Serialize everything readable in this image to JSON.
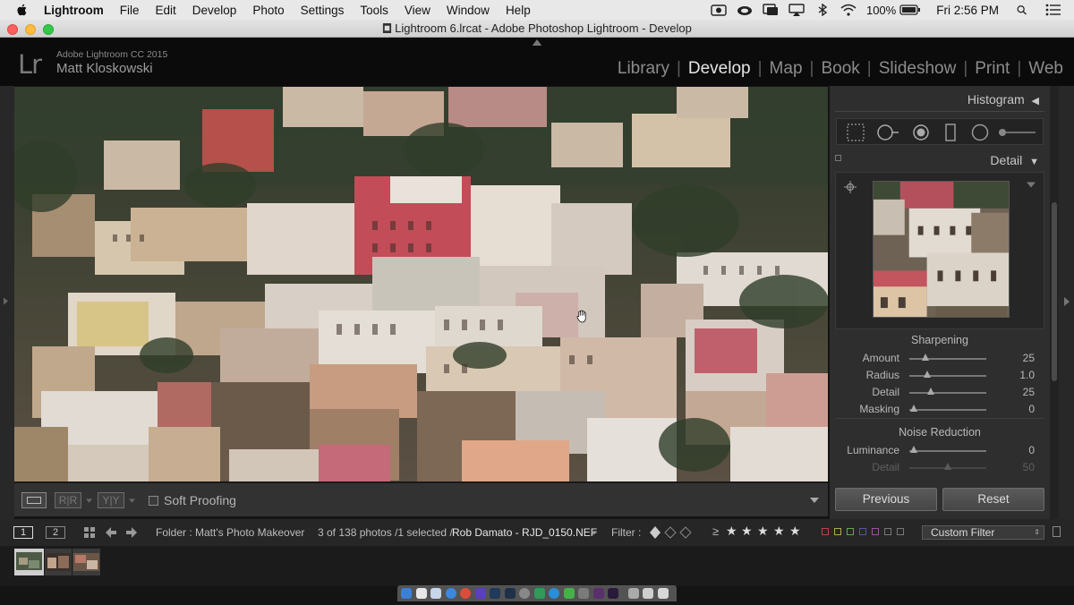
{
  "menubar": {
    "items": [
      "Lightroom",
      "File",
      "Edit",
      "Develop",
      "Photo",
      "Settings",
      "Tools",
      "View",
      "Window",
      "Help"
    ],
    "battery": "100%",
    "clock": "Fri 2:56 PM"
  },
  "window": {
    "title": "Lightroom 6.lrcat - Adobe Photoshop Lightroom - Develop"
  },
  "identity": {
    "logo": "Lr",
    "product": "Adobe Lightroom CC 2015",
    "user": "Matt Kloskowski"
  },
  "modules": [
    "Library",
    "Develop",
    "Map",
    "Book",
    "Slideshow",
    "Print",
    "Web"
  ],
  "active_module": "Develop",
  "right_panel": {
    "histogram_label": "Histogram",
    "detail_label": "Detail",
    "sharpening": {
      "title": "Sharpening",
      "sliders": [
        {
          "label": "Amount",
          "value": "25"
        },
        {
          "label": "Radius",
          "value": "1.0"
        },
        {
          "label": "Detail",
          "value": "25"
        },
        {
          "label": "Masking",
          "value": "0"
        }
      ]
    },
    "noise": {
      "title": "Noise Reduction",
      "sliders": [
        {
          "label": "Luminance",
          "value": "0"
        },
        {
          "label": "Detail",
          "value": "50"
        }
      ]
    },
    "previous_label": "Previous",
    "reset_label": "Reset"
  },
  "toolbar": {
    "soft_proofing_label": "Soft Proofing",
    "compare_ab": "R|R",
    "compare_yy": "Y|Y"
  },
  "filmstrip_bar": {
    "screen1": "1",
    "screen2": "2",
    "folder": "Folder : Matt's Photo Makeover",
    "count": "3 of 138 photos /1 selected /",
    "filename": "Rob Damato - RJD_0150.NEF",
    "filter_label": "Filter :",
    "rating_op": "≥",
    "custom_filter": "Custom Filter"
  },
  "colors": {
    "menubar": "#e8e8e8",
    "panel": "#2e2e2e",
    "active_module": "#e6e6e6",
    "inactive_module": "#8c8c8c"
  }
}
